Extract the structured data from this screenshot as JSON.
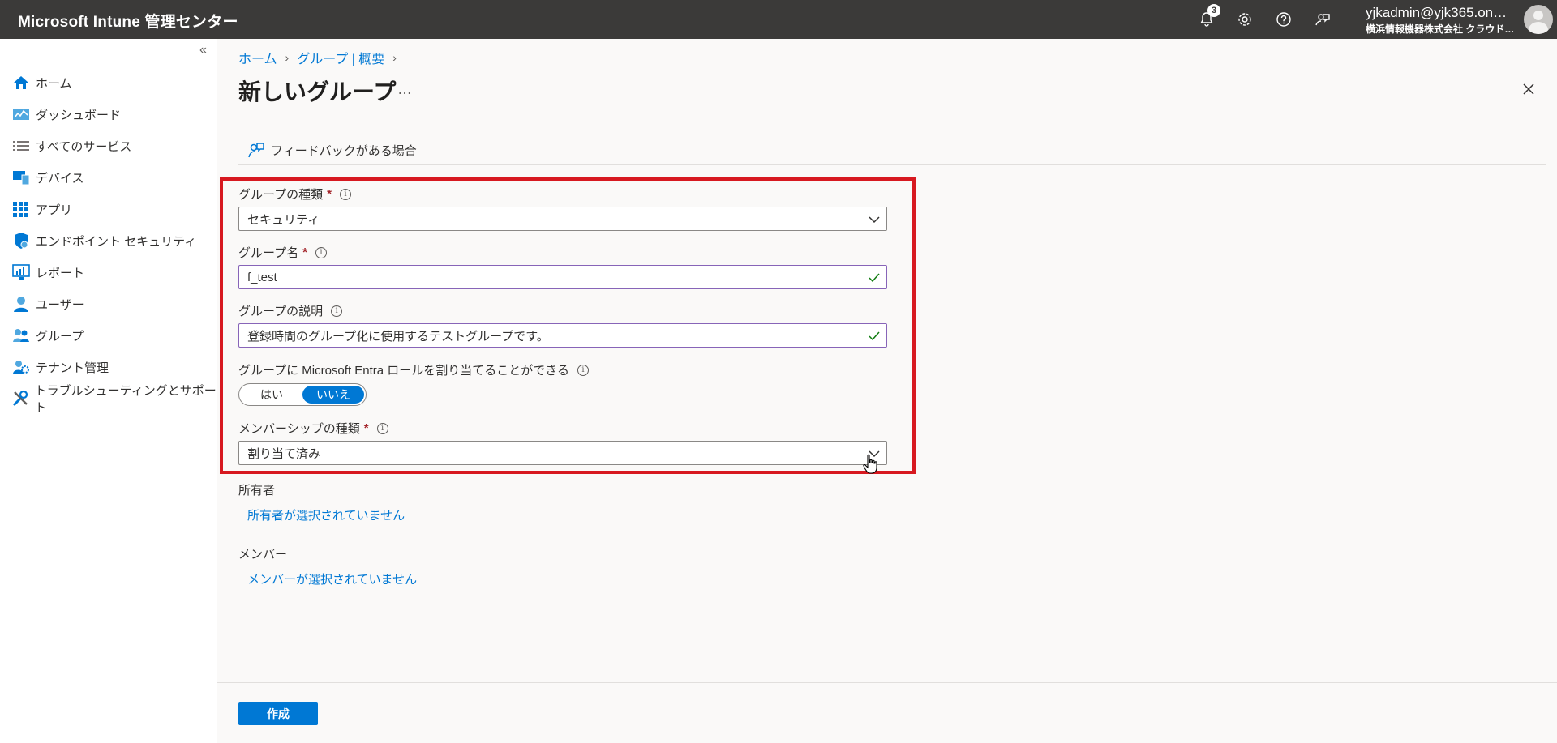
{
  "header": {
    "app_title": "Microsoft Intune 管理センター",
    "notification_count": "3",
    "account_user": "yjkadmin@yjk365.on…",
    "account_tenant": "横浜情報機器株式会社 クラウド…"
  },
  "sidebar": {
    "collapse_glyph": "«",
    "items": [
      {
        "label": "ホーム",
        "icon": "home-icon"
      },
      {
        "label": "ダッシュボード",
        "icon": "dashboard-icon"
      },
      {
        "label": "すべてのサービス",
        "icon": "all-services-icon"
      },
      {
        "label": "デバイス",
        "icon": "devices-icon"
      },
      {
        "label": "アプリ",
        "icon": "apps-icon"
      },
      {
        "label": "エンドポイント セキュリティ",
        "icon": "endpoint-security-icon"
      },
      {
        "label": "レポート",
        "icon": "reports-icon"
      },
      {
        "label": "ユーザー",
        "icon": "users-icon"
      },
      {
        "label": "グループ",
        "icon": "groups-icon"
      },
      {
        "label": "テナント管理",
        "icon": "tenant-admin-icon"
      },
      {
        "label": "トラブルシューティングとサポート",
        "icon": "troubleshooting-icon"
      }
    ]
  },
  "breadcrumb": {
    "home": "ホーム",
    "groups": "グループ | 概要"
  },
  "page": {
    "title": "新しいグループ",
    "more": "…",
    "feedback": "フィードバックがある場合"
  },
  "form": {
    "group_type": {
      "label": "グループの種類",
      "required": "*",
      "value": "セキュリティ"
    },
    "group_name": {
      "label": "グループ名",
      "required": "*",
      "value": "f_test"
    },
    "description": {
      "label": "グループの説明",
      "value": "登録時間のグループ化に使用するテストグループです。"
    },
    "entra_roles": {
      "label": "グループに Microsoft Entra ロールを割り当てることができる",
      "yes": "はい",
      "no": "いいえ",
      "selected": "いいえ"
    },
    "membership_type": {
      "label": "メンバーシップの種類",
      "required": "*",
      "value": "割り当て済み"
    },
    "owners": {
      "label": "所有者",
      "link": "所有者が選択されていません"
    },
    "members": {
      "label": "メンバー",
      "link": "メンバーが選択されていません"
    }
  },
  "footer": {
    "create_label": "作成"
  },
  "colors": {
    "topbar": "#3b3a39",
    "accent": "#0078d4",
    "highlight": "#d71920",
    "valid_check": "#107c10"
  }
}
